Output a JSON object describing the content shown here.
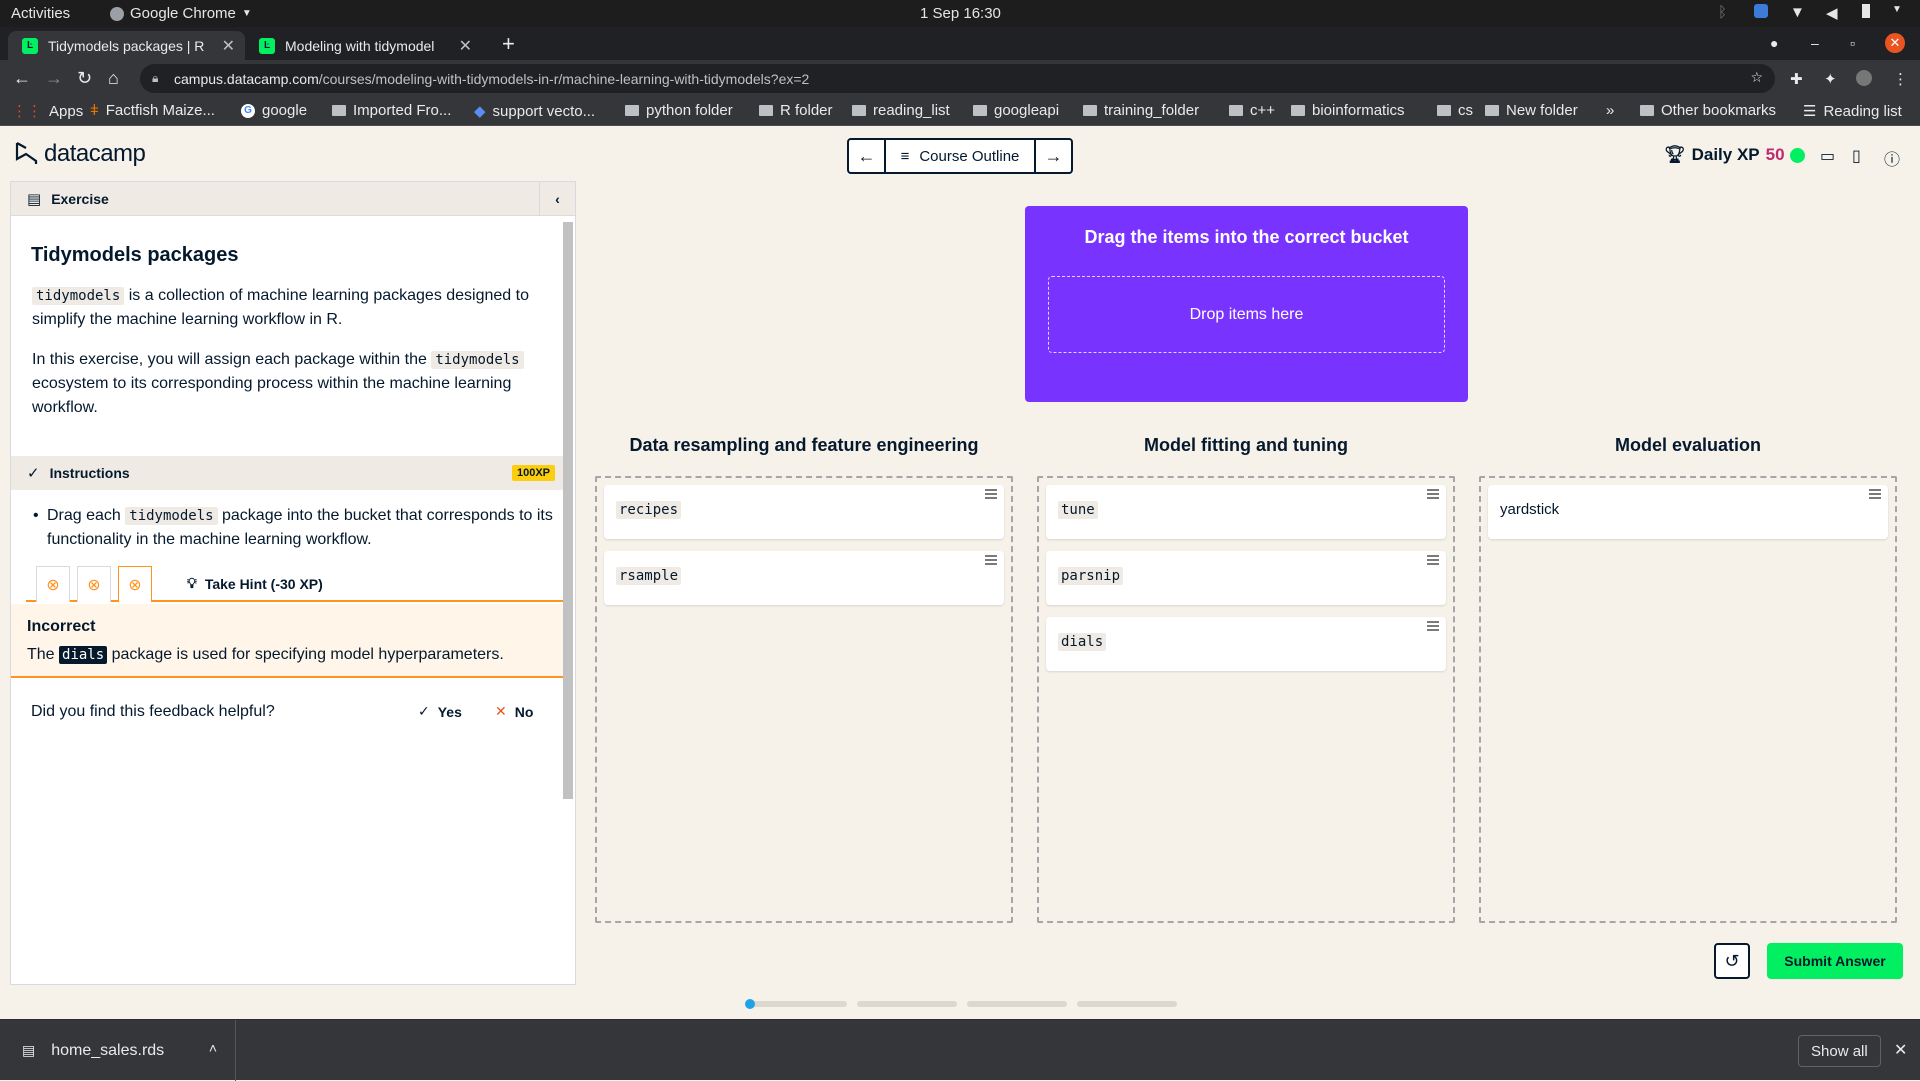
{
  "system": {
    "activities": "Activities",
    "app_name": "Google Chrome",
    "clock": "1 Sep  16:30"
  },
  "tabs": [
    {
      "title": "Tidymodels packages | R",
      "active": true
    },
    {
      "title": "Modeling with tidymodel",
      "active": false
    }
  ],
  "address": {
    "host": "campus.datacamp.com",
    "path": "/courses/modeling-with-tidymodels-in-r/machine-learning-with-tidymodels?ex=2"
  },
  "bookmarks": [
    "Apps",
    "Factfish Maize...",
    "google",
    "Imported Fro...",
    "support vecto...",
    "python folder",
    "R folder",
    "reading_list",
    "googleapi",
    "training_folder",
    "c++",
    "bioinformatics",
    "cs",
    "New folder",
    "»",
    "Other bookmarks",
    "Reading list"
  ],
  "header": {
    "logo_text": "datacamp",
    "course_outline": "Course Outline",
    "daily_xp_label": "Daily XP",
    "daily_xp_value": "50"
  },
  "exercise": {
    "panel_label": "Exercise",
    "title": "Tidymodels packages",
    "para1_code": "tidymodels",
    "para1_text": " is a collection of machine learning packages designed to simplify the machine learning workflow in R.",
    "para2_text_a": "In this exercise, you will assign each package within the ",
    "para2_code": "tidymodels",
    "para2_text_b": " ecosystem to its corresponding process within the machine learning workflow."
  },
  "instructions": {
    "label": "Instructions",
    "xp_badge": "100XP",
    "text_a": "Drag each ",
    "code": "tidymodels",
    "text_b": " package into the bucket that corresponds to its functionality in the machine learning workflow.",
    "take_hint": "Take Hint (-30 XP)"
  },
  "feedback": {
    "title": "Incorrect",
    "text_a": "The ",
    "code": "dials",
    "text_b": " package is used for specifying model hyperparameters.",
    "helpful_question": "Did you find this feedback helpful?",
    "yes": "Yes",
    "no": "No"
  },
  "dragdrop": {
    "heading": "Drag the items into the correct bucket",
    "drop_placeholder": "Drop items here",
    "buckets": [
      {
        "title": "Data resampling and feature engineering",
        "items": [
          "recipes",
          "rsample"
        ]
      },
      {
        "title": "Model fitting and tuning",
        "items": [
          "tune",
          "parsnip",
          "dials"
        ]
      },
      {
        "title": "Model evaluation",
        "items": [
          "yardstick"
        ]
      }
    ],
    "submit": "Submit Answer"
  },
  "downloads": {
    "file": "home_sales.rds",
    "show_all": "Show all"
  },
  "colors": {
    "accent_purple": "#7933ff",
    "submit_green": "#03ef62",
    "navy": "#05192d",
    "warning_orange": "#ff931e"
  }
}
